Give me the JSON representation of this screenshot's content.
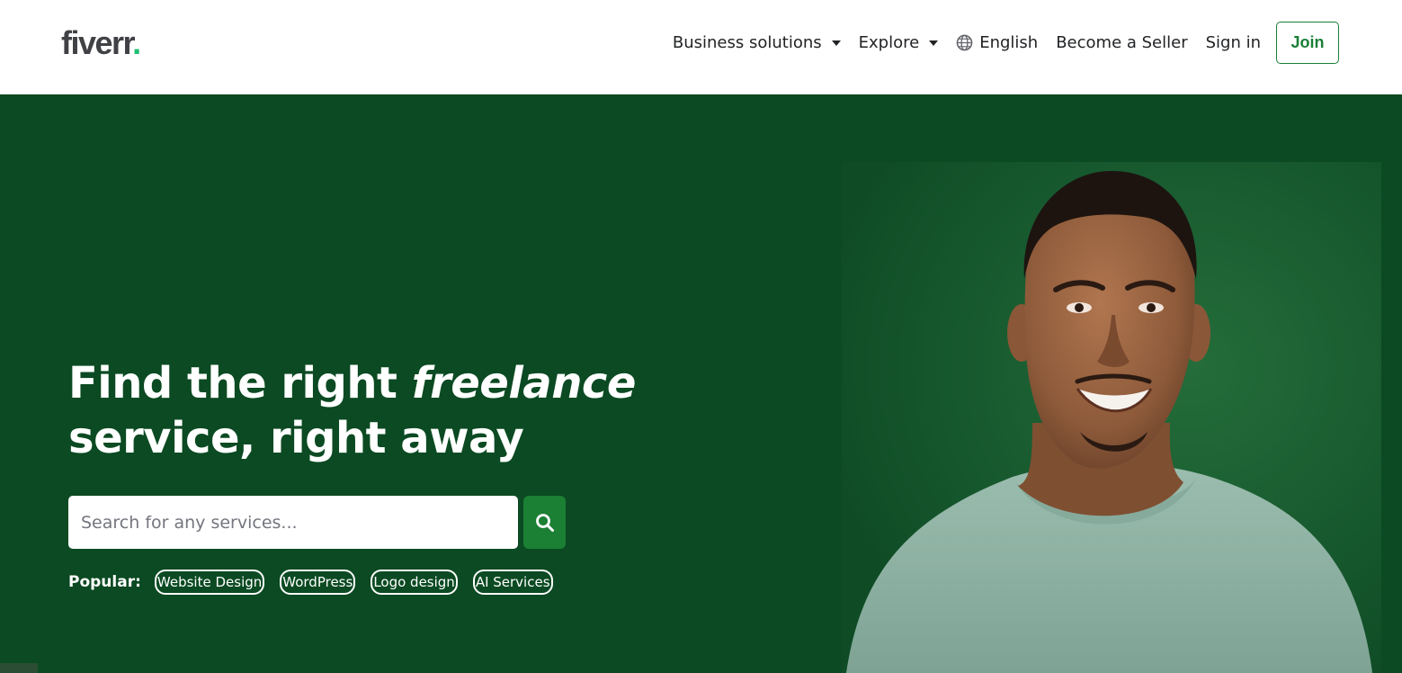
{
  "brand": {
    "logo_text": "fiverr",
    "logo_dot": ".",
    "logo_dot_color": "#1dbf73"
  },
  "nav": {
    "business_solutions": "Business solutions",
    "explore": "Explore",
    "language": "English",
    "become_seller": "Become a Seller",
    "sign_in": "Sign in",
    "join": "Join"
  },
  "hero": {
    "headline_part1": "Find the right ",
    "headline_emphasis": "freelance",
    "headline_part2": "service, right away",
    "search_placeholder": "Search for any services...",
    "popular_label": "Popular:",
    "popular_tags": [
      "Website Design",
      "WordPress",
      "Logo design",
      "AI Services"
    ]
  },
  "colors": {
    "hero_background": "#0b4a22",
    "accent_green": "#1b7f34",
    "join_green": "#1a7f37",
    "shirt": "#8fb3a4"
  },
  "icons": {
    "search": "search-icon",
    "globe": "globe-icon",
    "caret": "chevron-down-icon"
  }
}
